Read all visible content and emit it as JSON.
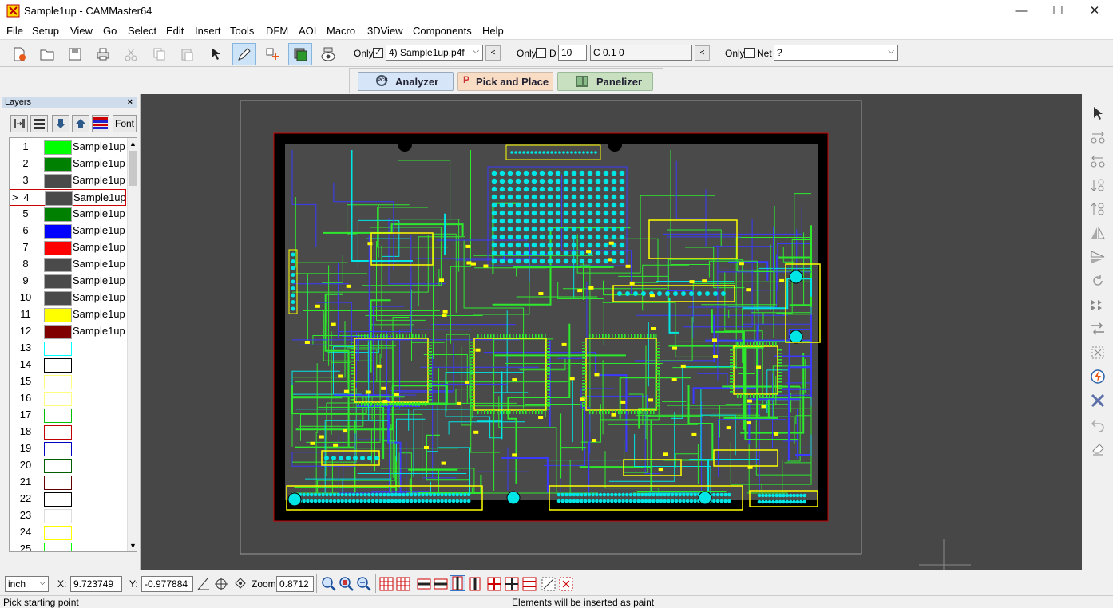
{
  "window": {
    "title": "Sample1up - CAMMaster64",
    "min_glyph": "—",
    "max_glyph": "☐",
    "close_glyph": "✕"
  },
  "menu": [
    "File",
    "Setup",
    "View",
    "Go",
    "Select",
    "Edit",
    "Insert",
    "Tools",
    "DFM",
    "AOI",
    "Macro",
    "3DView",
    "Components",
    "Help"
  ],
  "toolbar": {
    "only_label": "Only",
    "layer_select": "4) Sample1up.p4f",
    "only2_label": "Only",
    "d_label": "D",
    "d_value": "10",
    "c_value": "C 0.1  0",
    "only3_label": "Only",
    "net_label": "Net",
    "net_value": "?"
  },
  "modules": {
    "analyzer": "Analyzer",
    "pick_and_place": "Pick and Place",
    "panelizer": "Panelizer"
  },
  "layers_panel": {
    "title": "Layers",
    "close": "×",
    "font_button": "Font",
    "selected_marker": ">",
    "layers": [
      {
        "num": "1",
        "color": "#00ff00",
        "name": "Sample1up"
      },
      {
        "num": "2",
        "color": "#008000",
        "name": "Sample1up"
      },
      {
        "num": "3",
        "color": "#4a4a4a",
        "name": "Sample1up"
      },
      {
        "num": "4",
        "color": "#4a4a4a",
        "name": "Sample1up"
      },
      {
        "num": "5",
        "color": "#008000",
        "name": "Sample1up"
      },
      {
        "num": "6",
        "color": "#0000ff",
        "name": "Sample1up"
      },
      {
        "num": "7",
        "color": "#ff0000",
        "name": "Sample1up"
      },
      {
        "num": "8",
        "color": "#4a4a4a",
        "name": "Sample1up"
      },
      {
        "num": "9",
        "color": "#4a4a4a",
        "name": "Sample1up"
      },
      {
        "num": "10",
        "color": "#4a4a4a",
        "name": "Sample1up"
      },
      {
        "num": "11",
        "color": "#ffff00",
        "name": "Sample1up"
      },
      {
        "num": "12",
        "color": "#800000",
        "name": "Sample1up"
      },
      {
        "num": "13",
        "color": "#00ffff",
        "name": ""
      },
      {
        "num": "14",
        "color": "#000000",
        "name": ""
      },
      {
        "num": "15",
        "color": "#ffff80",
        "name": ""
      },
      {
        "num": "16",
        "color": "#ffff80",
        "name": ""
      },
      {
        "num": "17",
        "color": "#00c000",
        "name": ""
      },
      {
        "num": "18",
        "color": "#c00000",
        "name": ""
      },
      {
        "num": "19",
        "color": "#0000c0",
        "name": ""
      },
      {
        "num": "20",
        "color": "#006000",
        "name": ""
      },
      {
        "num": "21",
        "color": "#600000",
        "name": ""
      },
      {
        "num": "22",
        "color": "#000000",
        "name": ""
      },
      {
        "num": "23",
        "color": "#dddddd",
        "name": ""
      },
      {
        "num": "24",
        "color": "#ffff00",
        "name": ""
      },
      {
        "num": "25",
        "color": "#00ff00",
        "name": ""
      }
    ]
  },
  "bottom": {
    "units": "inch",
    "x_label": "X:",
    "x_value": "9.723749",
    "y_label": "Y:",
    "y_value": "-0.977884",
    "zoom_label": "Zoom:",
    "zoom_value": "0.8712"
  },
  "status": {
    "left": "Pick starting point",
    "center": "Elements will be inserted as paint"
  },
  "pcb_colors": {
    "top_trace": "#2ee82e",
    "bottom_trace": "#3b3bff",
    "pad": "#00e5e5",
    "silk": "#ffff00",
    "outline": "#cc0000",
    "board": "#000000"
  }
}
